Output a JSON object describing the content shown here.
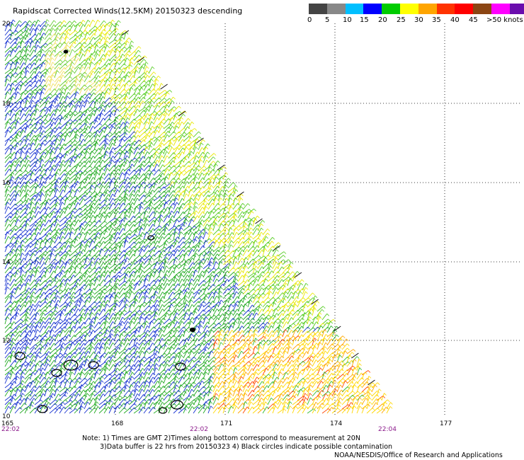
{
  "title": "Rapidscat Corrected Winds(12.5KM) 20150323 descending",
  "legend": {
    "colors": [
      "#444444",
      "#888888",
      "#00bfff",
      "#0000ff",
      "#00cc00",
      "#ffff00",
      "#ffa500",
      "#ff3300",
      "#ff0000",
      "#8b4513",
      "#ff00ff",
      "#6a0dad"
    ],
    "labels": [
      "0",
      "5",
      "10",
      "15",
      "20",
      "25",
      "30",
      "35",
      "40",
      "45",
      ">50 knots"
    ]
  },
  "axes": {
    "lat_ticks": [
      "20",
      "18",
      "16",
      "14",
      "12",
      "10"
    ],
    "lon_ticks": [
      "165",
      "168",
      "171",
      "174",
      "177"
    ],
    "time_ticks": [
      "22:02",
      "22:02",
      "22:04"
    ]
  },
  "notes": [
    "Note: 1) Times are GMT 2)Times along bottom correspond to measurement at 20N",
    "3)Data buffer is 22 hrs from 20150323 4) Black circles indicate possible contamination",
    "NOAA/NESDIS/Office of Research and Applications"
  ]
}
